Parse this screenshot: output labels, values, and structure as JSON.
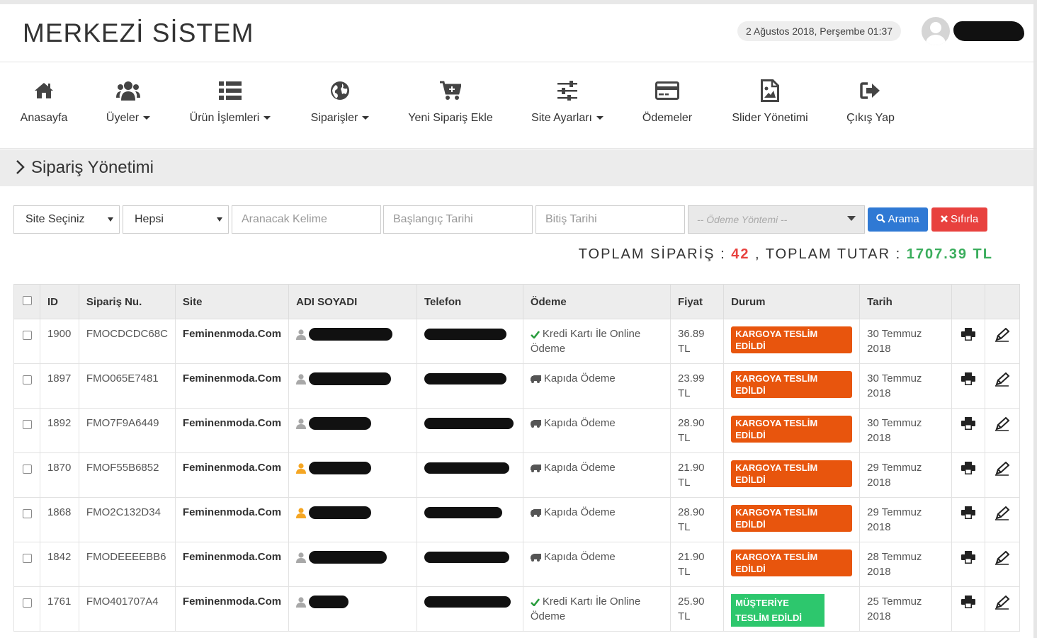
{
  "header": {
    "brand": "MERKEZİ SİSTEM",
    "datetime": "2 Ağustos 2018, Perşembe 01:37"
  },
  "nav": [
    {
      "label": "Anasayfa",
      "icon": "home-icon",
      "dropdown": false
    },
    {
      "label": "Üyeler",
      "icon": "users-icon",
      "dropdown": true
    },
    {
      "label": "Ürün İşlemleri",
      "icon": "list-icon",
      "dropdown": true
    },
    {
      "label": "Siparişler",
      "icon": "globe-icon",
      "dropdown": true
    },
    {
      "label": "Yeni Sipariş Ekle",
      "icon": "cart-plus-icon",
      "dropdown": false
    },
    {
      "label": "Site Ayarları",
      "icon": "sliders-icon",
      "dropdown": true
    },
    {
      "label": "Ödemeler",
      "icon": "credit-card-icon",
      "dropdown": false
    },
    {
      "label": "Slider Yönetimi",
      "icon": "image-file-icon",
      "dropdown": false
    },
    {
      "label": "Çıkış Yap",
      "icon": "sign-out-icon",
      "dropdown": false
    }
  ],
  "page": {
    "title": "Sipariş Yönetimi"
  },
  "filters": {
    "site_select": "Site Seçiniz",
    "status_select": "Hepsi",
    "keyword_placeholder": "Aranacak Kelime",
    "start_date_placeholder": "Başlangıç Tarihi",
    "end_date_placeholder": "Bitiş Tarihi",
    "payment_placeholder": "-- Ödeme Yöntemi --",
    "search_label": "Arama",
    "reset_label": "Sıfırla"
  },
  "totals": {
    "orders_label": "TOPLAM SİPARİŞ :",
    "orders_count": "42",
    "amount_label": ", TOPLAM TUTAR :",
    "amount_value": "1707.39 TL"
  },
  "table": {
    "columns": [
      "ID",
      "Sipariş Nu.",
      "Site",
      "ADI SOYADI",
      "Telefon",
      "Ödeme",
      "Fiyat",
      "Durum",
      "Tarih"
    ],
    "rows": [
      {
        "id": "1900",
        "order_no": "FMOCDCDC68C",
        "site": "Feminenmoda.Com",
        "user_color": "#a8a8a8",
        "payment": "Kredi Kartı İle Online Ödeme",
        "payment_icon": "check-icon",
        "price": "36.89 TL",
        "status": "KARGOYA TESLİM EDİLDİ",
        "status_color": "#e8550d",
        "date": "30 Temmuz 2018"
      },
      {
        "id": "1897",
        "order_no": "FMO065E7481",
        "site": "Feminenmoda.Com",
        "user_color": "#a8a8a8",
        "payment": "Kapıda Ödeme",
        "payment_icon": "truck-icon",
        "price": "23.99 TL",
        "status": "KARGOYA TESLİM EDİLDİ",
        "status_color": "#e8550d",
        "date": "30 Temmuz 2018"
      },
      {
        "id": "1892",
        "order_no": "FMO7F9A6449",
        "site": "Feminenmoda.Com",
        "user_color": "#a8a8a8",
        "payment": "Kapıda Ödeme",
        "payment_icon": "truck-icon",
        "price": "28.90 TL",
        "status": "KARGOYA TESLİM EDİLDİ",
        "status_color": "#e8550d",
        "date": "30 Temmuz 2018"
      },
      {
        "id": "1870",
        "order_no": "FMOF55B6852",
        "site": "Feminenmoda.Com",
        "user_color": "#f5a623",
        "payment": "Kapıda Ödeme",
        "payment_icon": "truck-icon",
        "price": "21.90 TL",
        "status": "KARGOYA TESLİM EDİLDİ",
        "status_color": "#e8550d",
        "date": "29 Temmuz 2018"
      },
      {
        "id": "1868",
        "order_no": "FMO2C132D34",
        "site": "Feminenmoda.Com",
        "user_color": "#f5a623",
        "payment": "Kapıda Ödeme",
        "payment_icon": "truck-icon",
        "price": "28.90 TL",
        "status": "KARGOYA TESLİM EDİLDİ",
        "status_color": "#e8550d",
        "date": "29 Temmuz 2018"
      },
      {
        "id": "1842",
        "order_no": "FMODEEEEBB6",
        "site": "Feminenmoda.Com",
        "user_color": "#a8a8a8",
        "payment": "Kapıda Ödeme",
        "payment_icon": "truck-icon",
        "price": "21.90 TL",
        "status": "KARGOYA TESLİM EDİLDİ",
        "status_color": "#e8550d",
        "date": "28 Temmuz 2018"
      },
      {
        "id": "1761",
        "order_no": "FMO401707A4",
        "site": "Feminenmoda.Com",
        "user_color": "#a8a8a8",
        "payment": "Kredi Kartı İle Online Ödeme",
        "payment_icon": "check-icon",
        "price": "25.90 TL",
        "status": "MÜŞTERİYE TESLİM EDİLDİ",
        "status_color": "#2dc76d",
        "date": "25 Temmuz 2018"
      }
    ]
  }
}
